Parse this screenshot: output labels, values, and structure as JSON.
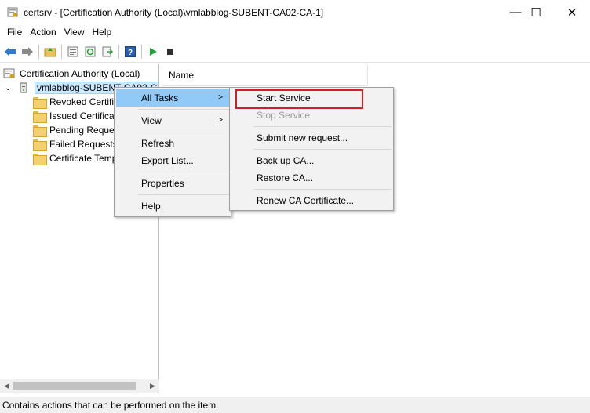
{
  "window": {
    "title": "certsrv - [Certification Authority (Local)\\vmlabblog-SUBENT-CA02-CA-1]",
    "minimize_glyph": "—",
    "maximize_glyph": "☐",
    "close_glyph": "✕"
  },
  "menubar": [
    "File",
    "Action",
    "View",
    "Help"
  ],
  "toolbar": {
    "icons": [
      "back-icon",
      "forward-icon",
      "up-folder-icon",
      "properties-icon",
      "refresh-icon",
      "export-list-icon",
      "help-icon",
      "start-service-icon",
      "stop-service-icon"
    ]
  },
  "tree": {
    "root": "Certification Authority (Local)",
    "ca_node": "vmlabblog-SUBENT-CA02-CA-1",
    "children": [
      "Revoked Certificates",
      "Issued Certificates",
      "Pending Requests",
      "Failed Requests",
      "Certificate Templates"
    ]
  },
  "list": {
    "column_name": "Name"
  },
  "context_menu": {
    "items": [
      "All Tasks",
      "View",
      "Refresh",
      "Export List...",
      "Properties",
      "Help"
    ],
    "submenu_arrow": ">"
  },
  "all_tasks_submenu": {
    "items": [
      "Start Service",
      "Stop Service",
      "Submit new request...",
      "Back up CA...",
      "Restore CA...",
      "Renew CA Certificate..."
    ]
  },
  "status": {
    "text": "Contains actions that can be performed on the item."
  },
  "colors": {
    "highlight": "#91c9f7",
    "callout": "#d01f26",
    "selection": "#cce8ff"
  }
}
